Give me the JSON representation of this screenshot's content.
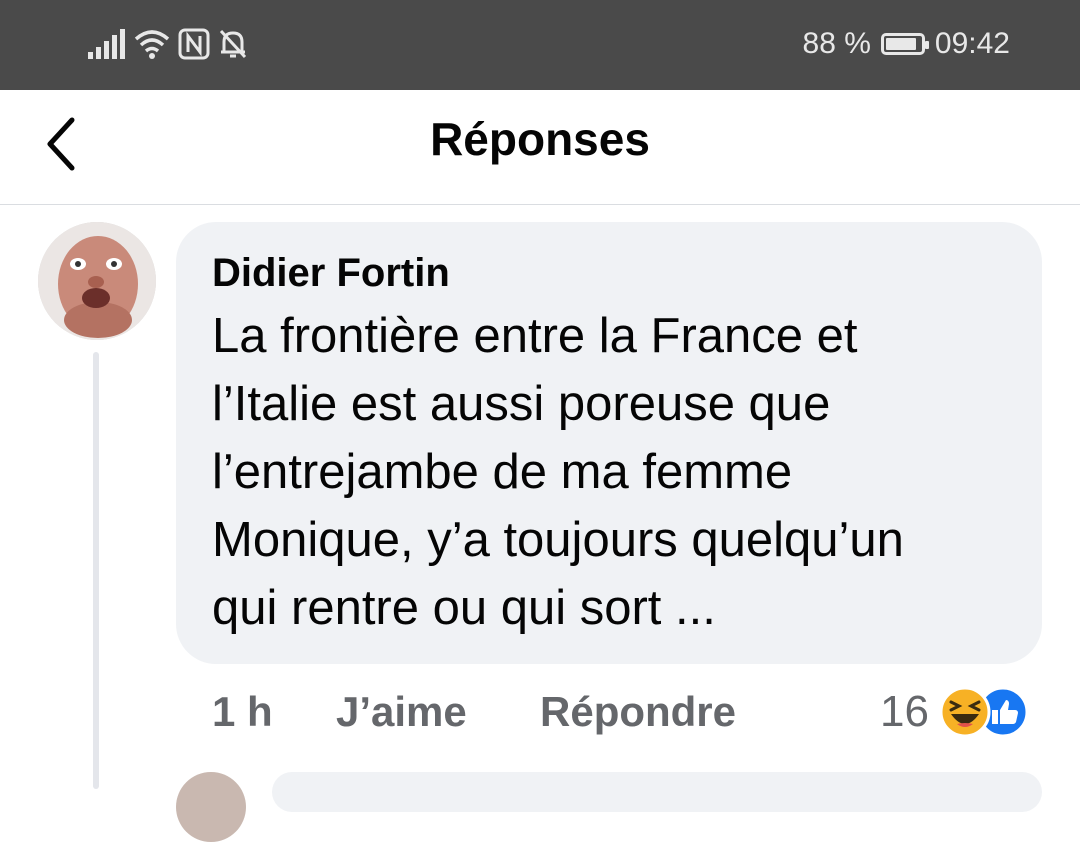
{
  "status_bar": {
    "battery": "88 %",
    "battery_level_percent": 88,
    "time": "09:42",
    "icons": [
      "signal-icon",
      "wifi-icon",
      "nfc-icon",
      "bell-off-icon",
      "battery-icon"
    ]
  },
  "header": {
    "title": "Réponses",
    "back_icon": "chevron-left-icon"
  },
  "comment": {
    "author": "Didier Fortin",
    "text": "La frontière entre la France et\nl’Italie est aussi poreuse que\nl’entrejambe de ma femme\nMonique, y’a toujours quelqu’un\nqui rentre ou qui sort ...",
    "time": "1 h",
    "like_label": "J’aime",
    "reply_label": "Répondre",
    "reaction_count": "16",
    "reactions": [
      "haha-reaction-icon",
      "like-reaction-icon"
    ]
  },
  "colors": {
    "status_bar_bg": "#4a4a4a",
    "bubble_bg": "#f0f2f5",
    "secondary_text": "#65676b",
    "like_blue": "#1877f2",
    "haha_yellow": "#f7b125"
  }
}
